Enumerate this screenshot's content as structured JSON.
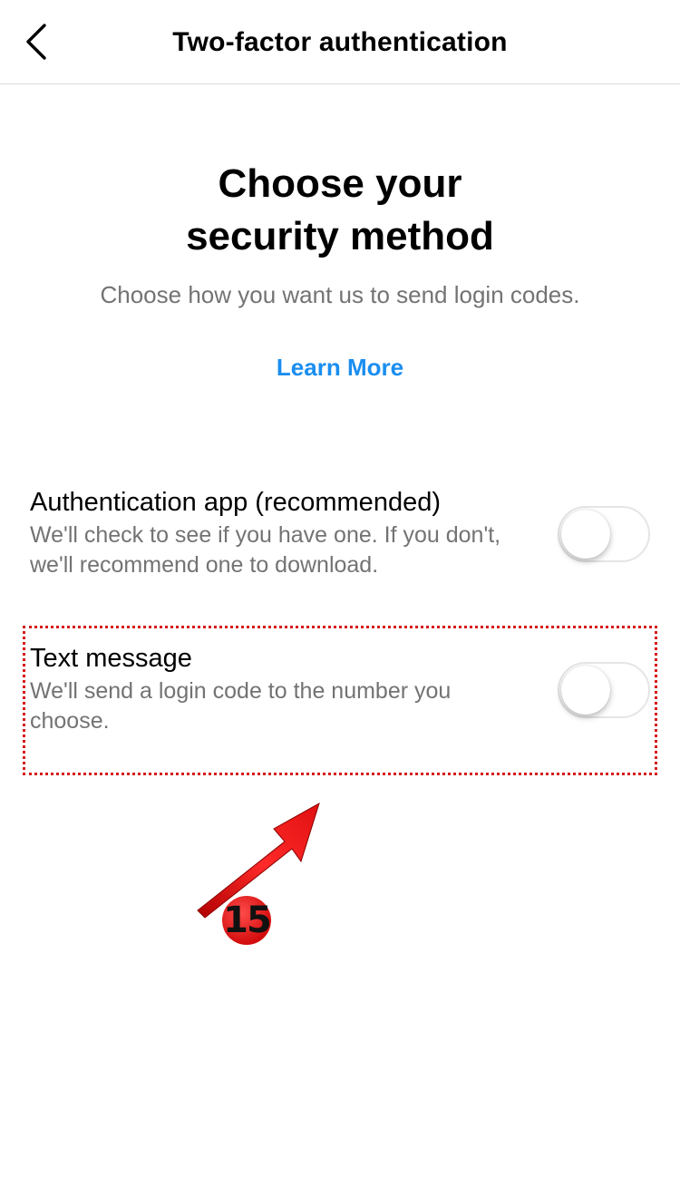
{
  "header": {
    "title": "Two-factor authentication",
    "back_icon": "chevron-left-icon"
  },
  "hero": {
    "title_line1": "Choose your",
    "title_line2": "security method",
    "subtitle": "Choose how you want us to send login codes.",
    "learn_more": "Learn More"
  },
  "options": [
    {
      "title": "Authentication app (recommended)",
      "description": "We'll check to see if you have one. If you don't, we'll recommend one to download.",
      "enabled": false
    },
    {
      "title": "Text message",
      "description": "We'll send a login code to the number you choose.",
      "enabled": false
    }
  ],
  "annotation": {
    "step_number": "15",
    "color": "#e01010"
  },
  "colors": {
    "link": "#1a8ef0",
    "secondary_text": "#737373",
    "divider": "#dbdbdb"
  }
}
